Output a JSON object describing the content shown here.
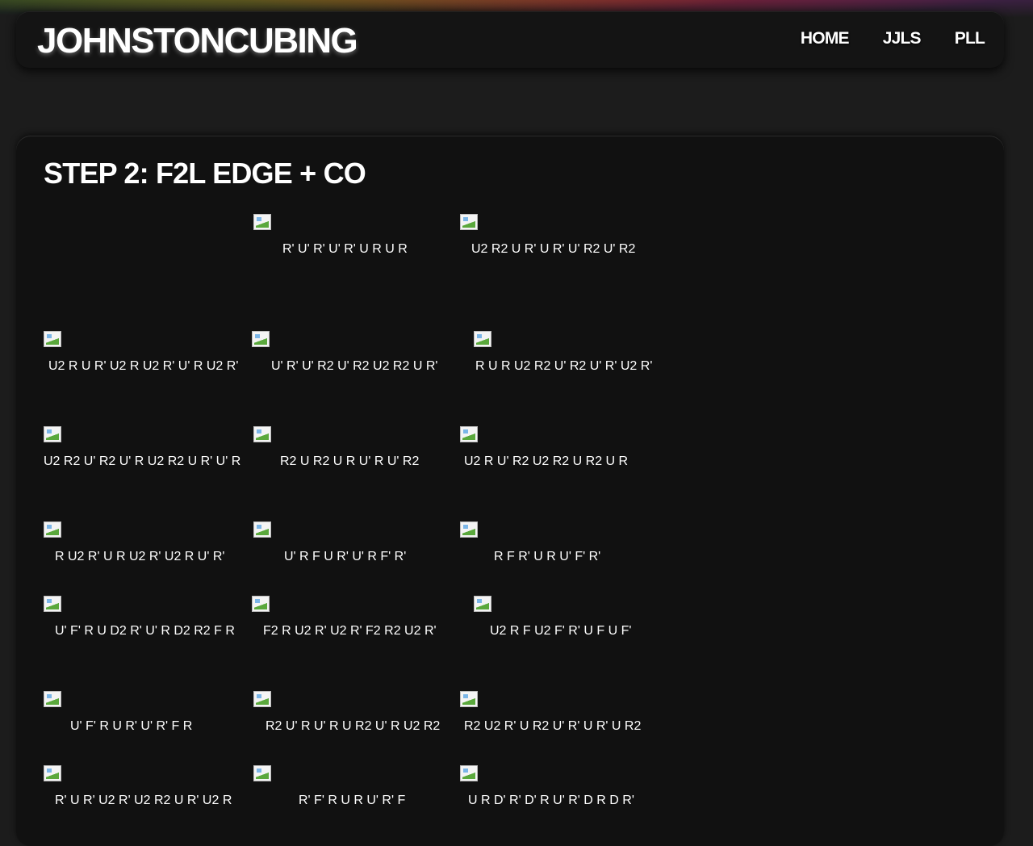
{
  "site": {
    "logo": "JOHNSTONCUBING"
  },
  "nav": [
    {
      "label": "HOME"
    },
    {
      "label": "JJLS"
    },
    {
      "label": "PLL"
    }
  ],
  "page": {
    "title": "STEP 2: F2L EDGE + CO"
  },
  "cases": [
    {
      "alg": "R' U' R' U' R' U R U R"
    },
    {
      "alg": "U2 R2 U R' U R' U' R2 U' R2"
    },
    {
      "alg": "U2 R U R' U2 R U2 R' U' R U2 R'"
    },
    {
      "alg": "U' R' U' R2 U' R2 U2 R2 U R'"
    },
    {
      "alg": "R U R U2 R2 U' R2 U' R' U2 R'"
    },
    {
      "alg": "U2 R2 U' R2 U' R U2 R2 U R' U' R"
    },
    {
      "alg": "R2 U R2 U R U' R U' R2"
    },
    {
      "alg": "U2 R U' R2 U2 R2 U R2 U R"
    },
    {
      "alg": "R U2 R' U R U2 R' U2 R U' R'"
    },
    {
      "alg": "U' R F U R' U' R F' R'"
    },
    {
      "alg": "R F R' U R U' F' R'"
    },
    {
      "alg": "U' F' R U D2 R' U' R D2 R2 F R"
    },
    {
      "alg": "F2 R U2 R' U2 R' F2 R2 U2 R'"
    },
    {
      "alg": "U2 R F U2 F' R' U F U F'"
    },
    {
      "alg": "U' F' R U R' U' R' F R"
    },
    {
      "alg": "R2 U' R U' R U R2 U' R U2 R2"
    },
    {
      "alg": "R2 U2 R' U R2 U' R' U R' U R2"
    },
    {
      "alg": "R' U R' U2 R' U2 R2 U R' U2 R"
    },
    {
      "alg": "R' F' R U R U' R' F"
    },
    {
      "alg": "U R D' R' D' R U' R' D R D R'"
    }
  ]
}
